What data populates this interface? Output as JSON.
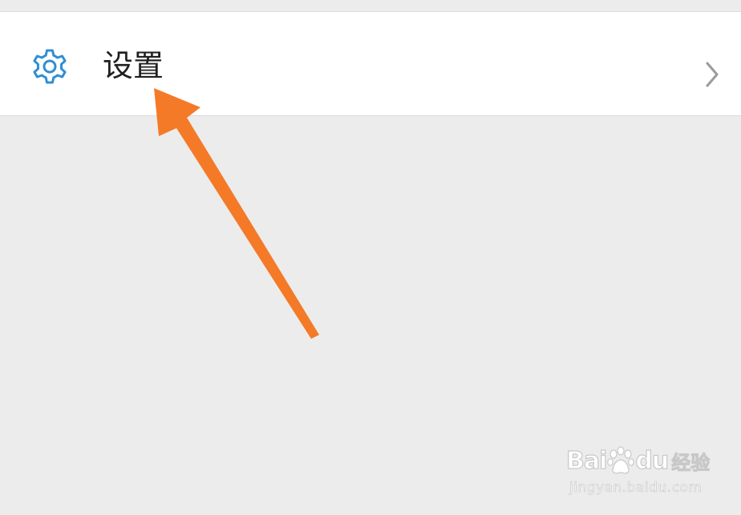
{
  "settings_row": {
    "label": "设置",
    "icon": "gear-icon",
    "trailing_icon": "chevron-right-icon",
    "icon_color": "#2f8fd1"
  },
  "annotation": {
    "type": "arrow",
    "color": "#f47a28"
  },
  "watermark": {
    "logo_left": "Bai",
    "logo_right": "du",
    "logo_suffix": "经验",
    "url": "jingyan.baidu.com"
  },
  "colors": {
    "background": "#ececec",
    "row_background": "#ffffff"
  }
}
